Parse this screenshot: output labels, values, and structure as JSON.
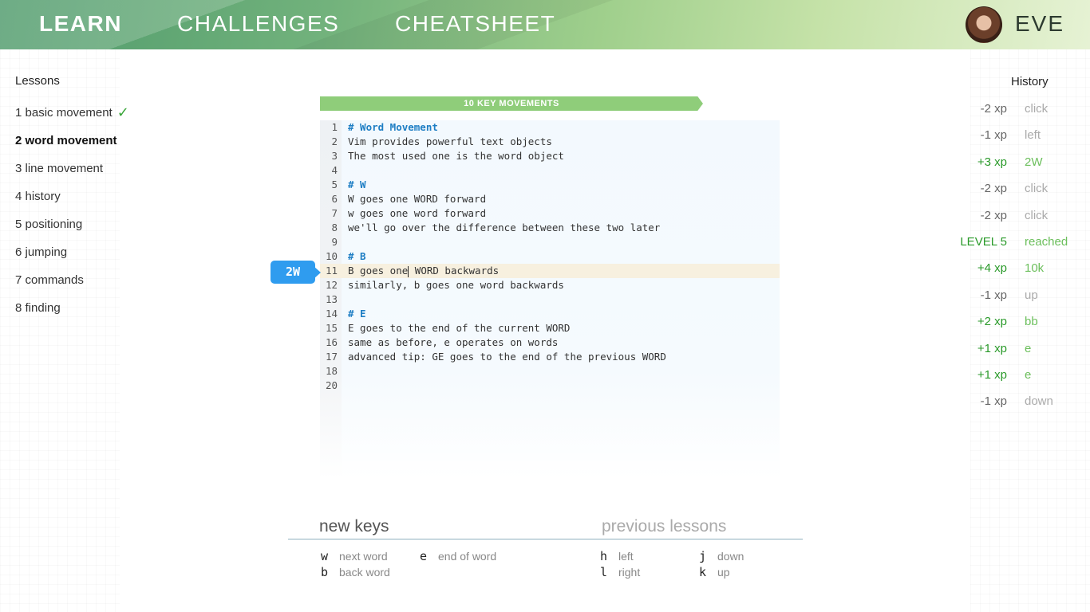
{
  "nav": {
    "learn": "LEARN",
    "challenges": "CHALLENGES",
    "cheatsheet": "CHEATSHEET",
    "username": "EVE"
  },
  "lessons": {
    "title": "Lessons",
    "items": [
      {
        "label": "1 basic movement",
        "completed": true
      },
      {
        "label": "2 word movement",
        "active": true
      },
      {
        "label": "3 line movement"
      },
      {
        "label": "4 history"
      },
      {
        "label": "5 positioning"
      },
      {
        "label": "6 jumping"
      },
      {
        "label": "7 commands"
      },
      {
        "label": "8 finding"
      }
    ]
  },
  "editor": {
    "banner": "10 KEY MOVEMENTS",
    "key_badge": "2W",
    "lines": [
      {
        "n": "1",
        "text": "# Word Movement",
        "heading": true
      },
      {
        "n": "2",
        "text": "Vim provides powerful text objects"
      },
      {
        "n": "3",
        "text": "The most used one is the word object"
      },
      {
        "n": "4",
        "text": ""
      },
      {
        "n": "5",
        "text": "# W",
        "heading": true
      },
      {
        "n": "6",
        "text": "W goes one WORD forward"
      },
      {
        "n": "7",
        "text": "w goes one word forward"
      },
      {
        "n": "8",
        "text": "we'll go over the difference between these two later"
      },
      {
        "n": "9",
        "text": ""
      },
      {
        "n": "10",
        "text": "# B",
        "heading": true
      },
      {
        "n": "11",
        "text_before": "B goes one",
        "text_after": " WORD backwards",
        "current": true
      },
      {
        "n": "12",
        "text": "similarly, b goes one word backwards"
      },
      {
        "n": "13",
        "text": ""
      },
      {
        "n": "14",
        "text": "# E",
        "heading": true
      },
      {
        "n": "15",
        "text": "E goes to the end of the current WORD"
      },
      {
        "n": "16",
        "text": "same as before, e operates on words"
      },
      {
        "n": "17",
        "text": "advanced tip: GE goes to the end of the previous WORD"
      },
      {
        "n": "18",
        "text": ""
      },
      {
        "n": "20",
        "text": ""
      }
    ]
  },
  "history": {
    "title": "History",
    "rows": [
      {
        "xp": "-2 xp",
        "action": "click",
        "positive": false
      },
      {
        "xp": "-1 xp",
        "action": "left",
        "positive": false
      },
      {
        "xp": "+3 xp",
        "action": "2W",
        "positive": true
      },
      {
        "xp": "-2 xp",
        "action": "click",
        "positive": false
      },
      {
        "xp": "-2 xp",
        "action": "click",
        "positive": false
      },
      {
        "xp": "LEVEL 5",
        "action": "reached",
        "positive": true
      },
      {
        "xp": "+4 xp",
        "action": "10k",
        "positive": true
      },
      {
        "xp": "-1 xp",
        "action": "up",
        "positive": false
      },
      {
        "xp": "+2 xp",
        "action": "bb",
        "positive": true
      },
      {
        "xp": "+1 xp",
        "action": "e",
        "positive": true
      },
      {
        "xp": "+1 xp",
        "action": "e",
        "positive": true
      },
      {
        "xp": "-1 xp",
        "action": "down",
        "positive": false
      }
    ]
  },
  "keys": {
    "new_title": "new keys",
    "prev_title": "previous lessons",
    "new_keys": [
      {
        "key": "w",
        "desc": "next word"
      },
      {
        "key": "e",
        "desc": "end of word"
      },
      {
        "key": "b",
        "desc": "back word"
      }
    ],
    "prev_keys": [
      {
        "key": "h",
        "desc": "left"
      },
      {
        "key": "j",
        "desc": "down"
      },
      {
        "key": "l",
        "desc": "right"
      },
      {
        "key": "k",
        "desc": "up"
      }
    ]
  }
}
